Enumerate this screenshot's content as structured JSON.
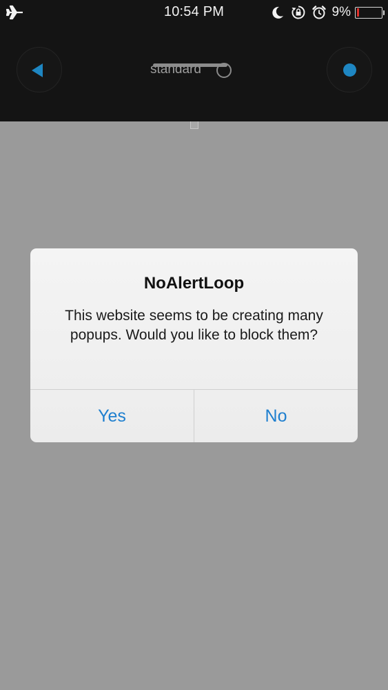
{
  "status_bar": {
    "time": "10:54 PM",
    "battery_percent": "9%",
    "battery_level": 0.09,
    "icons": [
      "airplane-icon",
      "moon-icon",
      "rotation-lock-icon",
      "alarm-icon",
      "battery-icon"
    ]
  },
  "toolbar": {
    "mode_label": "standard",
    "accent_color": "#1e86c2"
  },
  "alert": {
    "title": "NoAlertLoop",
    "message": "This website seems to be creating many popups. Would you like to block them?",
    "buttons": [
      {
        "label": "Yes"
      },
      {
        "label": "No"
      }
    ],
    "button_color": "#1e7fcf"
  },
  "colors": {
    "background": "#9a9a9a",
    "top_bar": "#141414",
    "battery_low": "#e0302b"
  }
}
